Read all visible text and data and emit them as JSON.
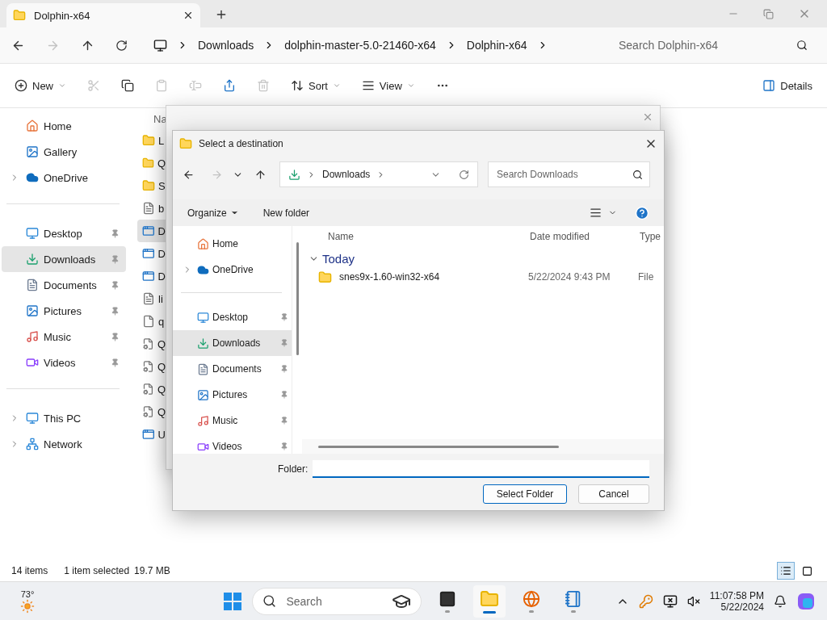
{
  "explorer": {
    "tab": {
      "title": "Dolphin-x64"
    },
    "breadcrumb": [
      "Downloads",
      "dolphin-master-5.0-21460-x64",
      "Dolphin-x64"
    ],
    "search": {
      "placeholder": "Search Dolphin-x64"
    },
    "toolbar": [
      {
        "kind": "new",
        "label": "New",
        "disabled": false
      },
      {
        "kind": "cut",
        "disabled": true
      },
      {
        "kind": "copy",
        "disabled": false
      },
      {
        "kind": "paste",
        "disabled": true
      },
      {
        "kind": "rename",
        "disabled": true
      },
      {
        "kind": "share",
        "disabled": false
      },
      {
        "kind": "delete",
        "disabled": true
      },
      {
        "kind": "sort",
        "label": "Sort",
        "disabled": false
      },
      {
        "kind": "view",
        "label": "View",
        "disabled": false
      },
      {
        "kind": "more",
        "disabled": false
      }
    ],
    "details": "Details",
    "sidebar": [
      {
        "items": [
          {
            "kind": "home",
            "label": "Home",
            "expandable": false,
            "pinned": false,
            "selected": false
          },
          {
            "kind": "gallery",
            "label": "Gallery",
            "expandable": false,
            "pinned": false,
            "selected": false
          },
          {
            "kind": "cloud",
            "label": "OneDrive",
            "expandable": true,
            "pinned": false,
            "selected": false
          }
        ]
      },
      {
        "items": [
          {
            "kind": "desktop",
            "label": "Desktop",
            "expandable": false,
            "pinned": true,
            "selected": false
          },
          {
            "kind": "downloads",
            "label": "Downloads",
            "expandable": false,
            "pinned": true,
            "selected": true
          },
          {
            "kind": "documents",
            "label": "Documents",
            "expandable": false,
            "pinned": true,
            "selected": false
          },
          {
            "kind": "pictures",
            "label": "Pictures",
            "expandable": false,
            "pinned": true,
            "selected": false
          },
          {
            "kind": "music",
            "label": "Music",
            "expandable": false,
            "pinned": true,
            "selected": false
          },
          {
            "kind": "videos",
            "label": "Videos",
            "expandable": false,
            "pinned": true,
            "selected": false
          }
        ]
      },
      {
        "items": [
          {
            "kind": "pc",
            "label": "This PC",
            "expandable": true,
            "pinned": false,
            "selected": false
          },
          {
            "kind": "network",
            "label": "Network",
            "expandable": true,
            "pinned": false,
            "selected": false
          }
        ]
      }
    ],
    "column_1": "Na",
    "files": [
      {
        "kind": "folder",
        "name": "L",
        "selected": false
      },
      {
        "kind": "folder",
        "name": "Q",
        "selected": false
      },
      {
        "kind": "folder",
        "name": "S",
        "selected": false
      },
      {
        "kind": "text",
        "name": "b",
        "selected": false
      },
      {
        "kind": "app",
        "name": "D",
        "selected": true
      },
      {
        "kind": "app",
        "name": "D",
        "selected": false
      },
      {
        "kind": "app",
        "name": "D",
        "selected": false
      },
      {
        "kind": "text",
        "name": "li",
        "selected": false
      },
      {
        "kind": "blank",
        "name": "q",
        "selected": false
      },
      {
        "kind": "config",
        "name": "Q",
        "selected": false
      },
      {
        "kind": "config",
        "name": "Q",
        "selected": false
      },
      {
        "kind": "config",
        "name": "Q",
        "selected": false
      },
      {
        "kind": "config",
        "name": "Q",
        "selected": false
      },
      {
        "kind": "app",
        "name": "U",
        "selected": false
      }
    ],
    "status": {
      "count": "14 items",
      "selection": "1 item selected",
      "size": "19.7 MB"
    },
    "view_modes": [
      {
        "kind": "details",
        "selected": true
      },
      {
        "kind": "tiles",
        "selected": false
      }
    ]
  },
  "dialog": {
    "title": "Select a destination",
    "location": "Downloads",
    "search": {
      "placeholder": "Search Downloads"
    },
    "commands": [
      {
        "label": "Organize",
        "dropdown": true
      },
      {
        "label": "New folder",
        "dropdown": false
      }
    ],
    "nav": [
      {
        "items": [
          {
            "kind": "home",
            "label": "Home",
            "expandable": false,
            "pinned": false,
            "selected": false
          },
          {
            "kind": "cloud",
            "label": "OneDrive",
            "expandable": true,
            "pinned": false,
            "selected": false
          }
        ]
      },
      {
        "items": [
          {
            "kind": "desktop",
            "label": "Desktop",
            "expandable": false,
            "pinned": true,
            "selected": false
          },
          {
            "kind": "downloads",
            "label": "Downloads",
            "expandable": false,
            "pinned": true,
            "selected": true
          },
          {
            "kind": "documents",
            "label": "Documents",
            "expandable": false,
            "pinned": true,
            "selected": false
          },
          {
            "kind": "pictures",
            "label": "Pictures",
            "expandable": false,
            "pinned": true,
            "selected": false
          },
          {
            "kind": "music",
            "label": "Music",
            "expandable": false,
            "pinned": true,
            "selected": false
          },
          {
            "kind": "videos",
            "label": "Videos",
            "expandable": false,
            "pinned": true,
            "selected": false
          }
        ]
      }
    ],
    "columns": [
      "Name",
      "Date modified",
      "Type"
    ],
    "groups": [
      {
        "label": "Today",
        "expanded": true,
        "rows": [
          {
            "name": "snes9x-1.60-win32-x64",
            "date": "5/22/2024 9:43 PM",
            "type": "File"
          }
        ]
      }
    ],
    "folder_label": "Folder:",
    "buttons": [
      {
        "label": "Select Folder",
        "default": true
      },
      {
        "label": "Cancel",
        "default": false
      }
    ]
  },
  "taskbar": {
    "weather": "73°",
    "search": {
      "placeholder": "Search"
    },
    "apps": [
      {
        "kind": "taskview",
        "active": false
      },
      {
        "kind": "explorer",
        "active": true
      },
      {
        "kind": "browser",
        "active": false
      },
      {
        "kind": "notepad",
        "active": false
      }
    ],
    "time": "11:07:58 PM",
    "date": "5/22/2024"
  }
}
